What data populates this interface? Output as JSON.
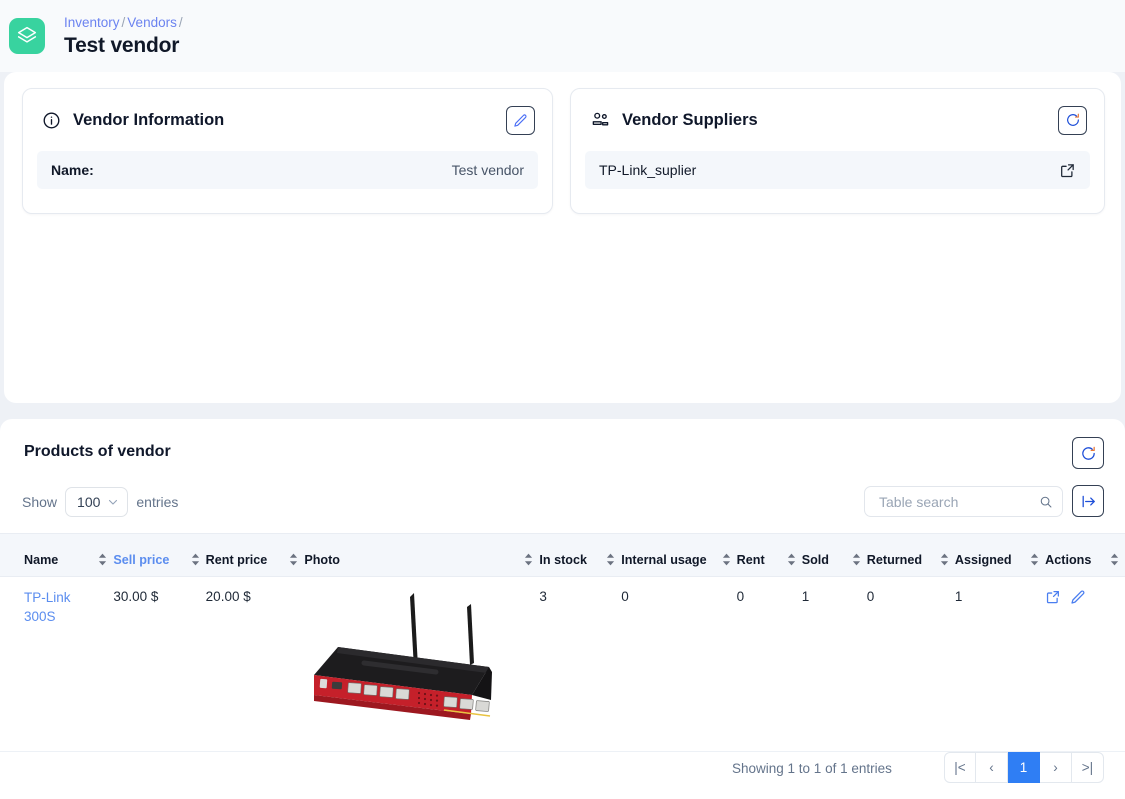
{
  "header": {
    "logo_icon": "layers-icon",
    "breadcrumb": [
      {
        "label": "Inventory",
        "link": true
      },
      {
        "label": "/",
        "link": false
      },
      {
        "label": "Vendors",
        "link": true
      },
      {
        "label": "/",
        "link": false
      }
    ],
    "title": "Test vendor"
  },
  "vendor_information": {
    "icon": "info-circle-icon",
    "title": "Vendor Information",
    "edit_button_icon": "pencil-icon",
    "rows": [
      {
        "key": "Name:",
        "value": "Test vendor"
      }
    ]
  },
  "vendor_suppliers": {
    "icon": "users-icon",
    "title": "Vendor Suppliers",
    "refresh_button_icon": "refresh-icon",
    "rows": [
      {
        "label": "TP-Link_suplier",
        "action_icon": "external-link-icon"
      }
    ]
  },
  "products": {
    "title": "Products of vendor",
    "refresh_button_icon": "refresh-icon",
    "show_label": "Show",
    "entries_label": "entries",
    "page_size": "100",
    "search": {
      "placeholder": "Table search",
      "value": "",
      "icon": "search-icon"
    },
    "export_button_icon": "arrow-bar-right-icon",
    "columns": [
      {
        "label": "Name",
        "sorted": false
      },
      {
        "label": "Sell price",
        "sorted": true
      },
      {
        "label": "Rent price",
        "sorted": false
      },
      {
        "label": "Photo",
        "sorted": false
      },
      {
        "label": "In stock",
        "sorted": false
      },
      {
        "label": "Internal usage",
        "sorted": false
      },
      {
        "label": "Rent",
        "sorted": false
      },
      {
        "label": "Sold",
        "sorted": false
      },
      {
        "label": "Returned",
        "sorted": false
      },
      {
        "label": "Assigned",
        "sorted": false
      },
      {
        "label": "Actions",
        "sorted": false
      }
    ],
    "rows": [
      {
        "name": "TP-Link 300S",
        "sell_price": "30.00 $",
        "rent_price": "20.00 $",
        "photo_alt": "router-photo",
        "in_stock": "3",
        "internal_usage": "0",
        "rent": "0",
        "sold": "1",
        "returned": "0",
        "assigned": "1",
        "actions": [
          "external-link-icon",
          "pencil-icon"
        ]
      }
    ],
    "footer": {
      "showing": "Showing 1 to 1 of 1 entries",
      "pagination": [
        {
          "label": "|<",
          "name": "first-page",
          "active": false
        },
        {
          "label": "‹",
          "name": "prev-page",
          "active": false
        },
        {
          "label": "1",
          "name": "page-1",
          "active": true
        },
        {
          "label": "›",
          "name": "next-page",
          "active": false
        },
        {
          "label": ">|",
          "name": "last-page",
          "active": false
        }
      ]
    }
  },
  "colors": {
    "logo_green": "#38d39f",
    "link_blue": "#5b8def",
    "pager_active": "#2f7ef4",
    "page_bg": "#eef1f6",
    "row_bg": "#f4f7fb"
  }
}
